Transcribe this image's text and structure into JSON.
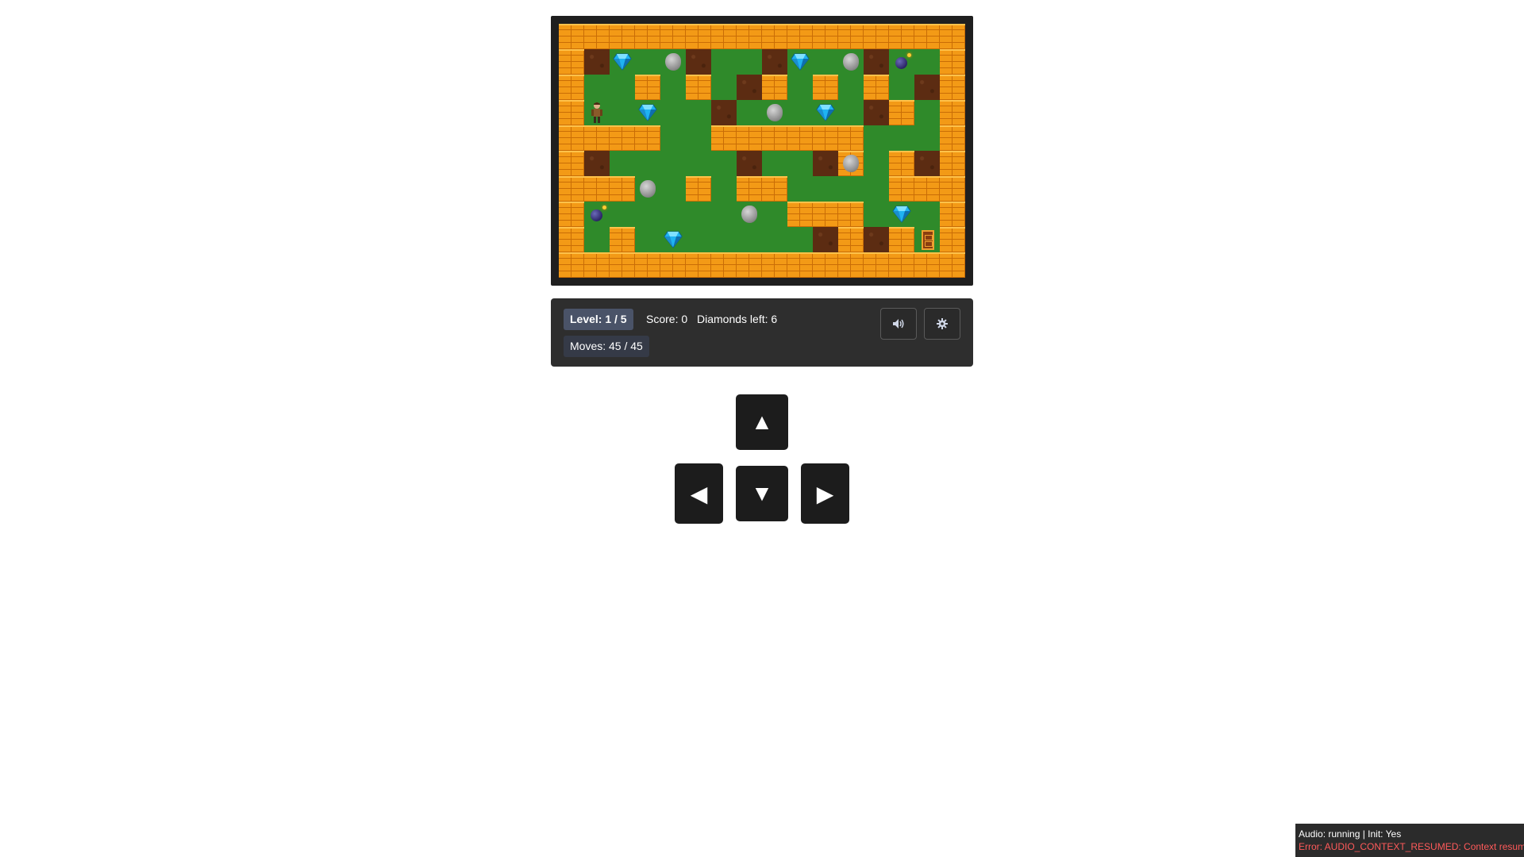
{
  "game": {
    "board": {
      "legend": {
        "W": "brick-wall",
        "F": "grass-floor",
        "D": "dirt"
      },
      "rows": [
        "WWWWWWWWWWWWWWWW",
        "WDFFFDFFDFFFDFFW",
        "WFFWFWFDWFWFWFDW",
        "WFFFFFDFFFFFDWFW",
        "WWWWFFWWWWWWFFFW",
        "WDFFFFFDFFDWFWDW",
        "WWWFFWFWWFFFFWWW",
        "WFFFFFFFFWWWFFFW",
        "WFWFFFFFFFDWDWFW",
        "WWWWWWWWWWWWWWWW"
      ],
      "objects": [
        {
          "type": "diamond",
          "row": 1,
          "col": 2
        },
        {
          "type": "boulder",
          "row": 1,
          "col": 4
        },
        {
          "type": "diamond",
          "row": 1,
          "col": 9
        },
        {
          "type": "boulder",
          "row": 1,
          "col": 11
        },
        {
          "type": "bomb",
          "row": 1,
          "col": 13
        },
        {
          "type": "player",
          "row": 3,
          "col": 1
        },
        {
          "type": "diamond",
          "row": 3,
          "col": 3
        },
        {
          "type": "boulder",
          "row": 3,
          "col": 8
        },
        {
          "type": "diamond",
          "row": 3,
          "col": 10
        },
        {
          "type": "boulder",
          "row": 5,
          "col": 11
        },
        {
          "type": "boulder",
          "row": 6,
          "col": 3
        },
        {
          "type": "bomb",
          "row": 7,
          "col": 1
        },
        {
          "type": "boulder",
          "row": 7,
          "col": 7
        },
        {
          "type": "diamond",
          "row": 7,
          "col": 13
        },
        {
          "type": "diamond",
          "row": 8,
          "col": 4
        },
        {
          "type": "exit-door",
          "row": 8,
          "col": 14
        }
      ]
    }
  },
  "hud": {
    "level": "Level: 1 / 5",
    "score": "Score: 0",
    "diamonds_left": "Diamonds left: 6",
    "moves": "Moves: 45 / 45",
    "sound_icon": "speaker-icon",
    "settings_icon": "gear-icon"
  },
  "controls": {
    "up": "▲",
    "left": "◀",
    "down": "▼",
    "right": "▶"
  },
  "status": {
    "audio": "Audio: running | Init: Yes",
    "error": "Error: AUDIO_CONTEXT_RESUMED: Context resumed"
  },
  "colors": {
    "brick": "#f39a16",
    "grass": "#2f8a2a",
    "dirt": "#5c2c12",
    "panel": "#2e2e2e",
    "error_text": "#ff5a5a"
  }
}
